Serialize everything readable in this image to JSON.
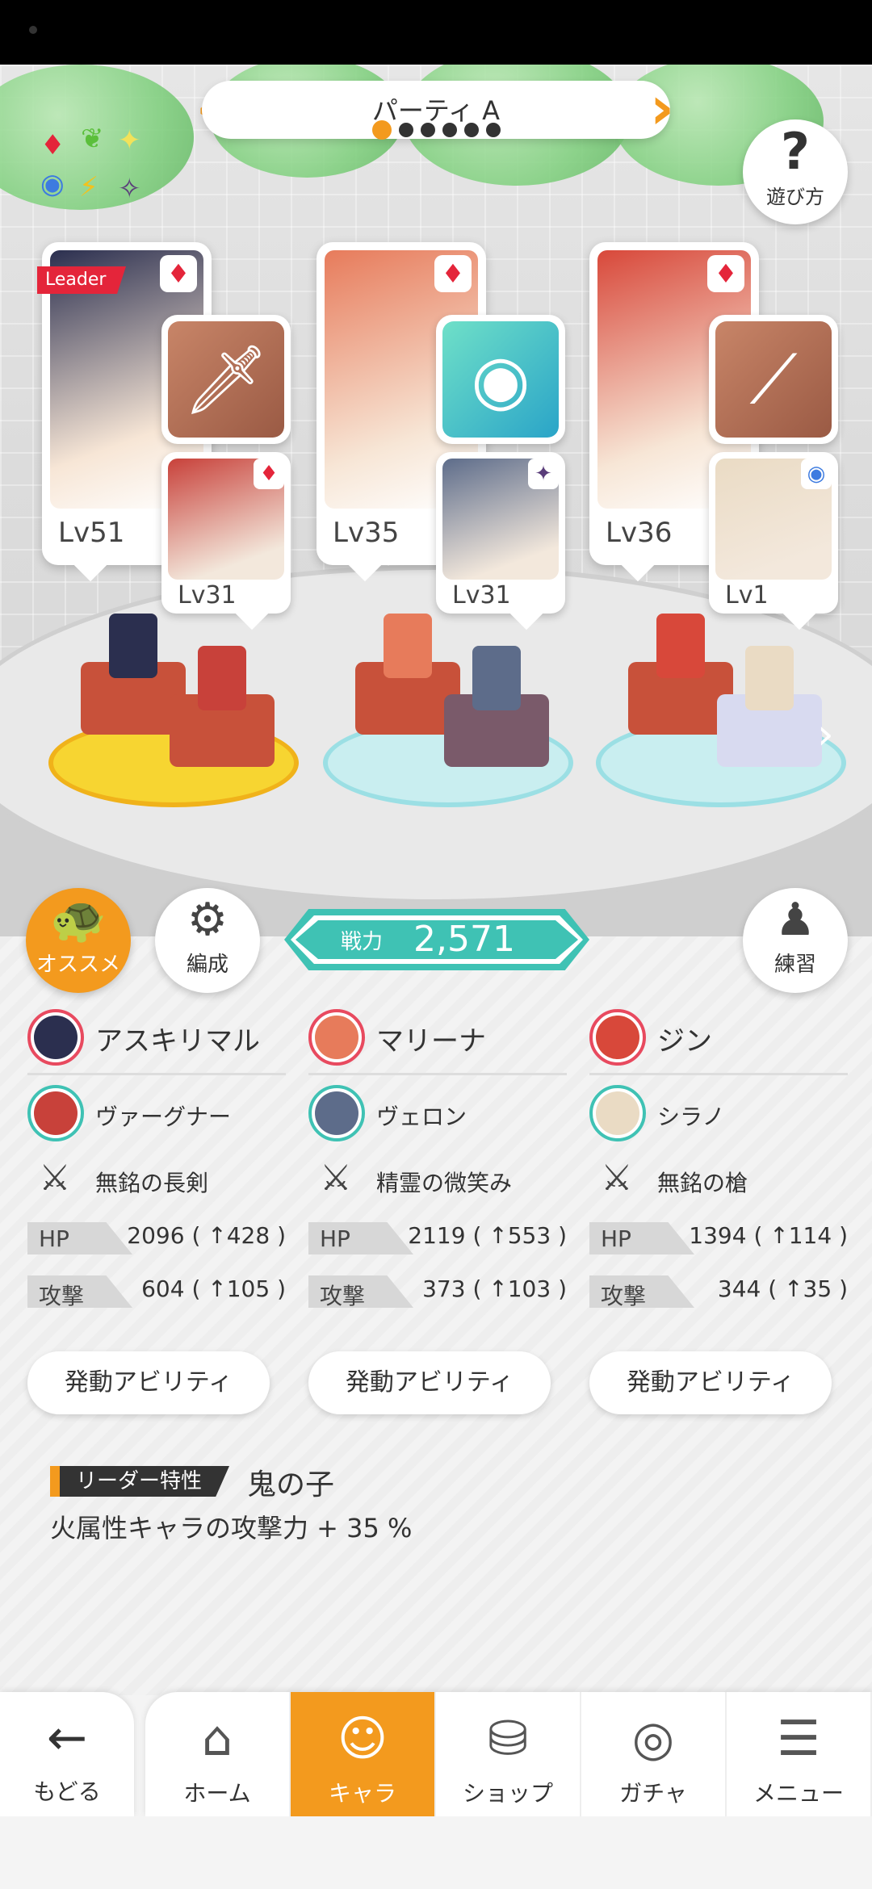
{
  "header": {
    "party_title": "パーティ A",
    "party_page_count": 6,
    "party_page_active": 0,
    "help_label": "遊び方",
    "help_icon": "question-icon"
  },
  "elements": {
    "symbols": [
      "♦",
      "❦",
      "✦",
      "◉",
      "⚡",
      "✧"
    ],
    "colors": [
      "#e4253a",
      "#5bbf3b",
      "#f2e25a",
      "#3d7be0",
      "#f2c21e",
      "#5a3d7a"
    ]
  },
  "leader_badge": "Leader",
  "team": [
    {
      "main": {
        "name": "アスキリマル",
        "level": "Lv51",
        "suit": "♦",
        "color": "#2b2f4f"
      },
      "sub": {
        "name": "ヴァーグナー",
        "level": "Lv31",
        "badge": "♦",
        "badge_color": "#e4253a",
        "color": "#c8413a"
      },
      "weapon": {
        "name": "無銘の長剣",
        "glyph": "🗡",
        "color": "#b06a4e"
      },
      "hp": "2096 ( ↑428 )",
      "atk": "604 ( ↑105 )"
    },
    {
      "main": {
        "name": "マリーナ",
        "level": "Lv35",
        "suit": "♦",
        "color": "#e77b5b"
      },
      "sub": {
        "name": "ヴェロン",
        "level": "Lv31",
        "badge": "✦",
        "badge_color": "#5a3d7a",
        "color": "#5d6c8a"
      },
      "weapon": {
        "name": "精霊の微笑み",
        "glyph": "◉",
        "color": "#3fc2b4"
      },
      "hp": "2119 ( ↑553 )",
      "atk": "373 ( ↑103 )"
    },
    {
      "main": {
        "name": "ジン",
        "level": "Lv36",
        "suit": "♦",
        "color": "#d8483a"
      },
      "sub": {
        "name": "シラノ",
        "level": "Lv1",
        "badge": "◉",
        "badge_color": "#3d7be0",
        "color": "#eadbc4"
      },
      "weapon": {
        "name": "無銘の槍",
        "glyph": "⟋",
        "color": "#b06a4e"
      },
      "hp": "1394 ( ↑114 )",
      "atk": "344 ( ↑35 )"
    }
  ],
  "stats_labels": {
    "hp": "HP",
    "atk": "攻撃"
  },
  "power": {
    "label": "戦力",
    "value": "2,571"
  },
  "actions": {
    "recommend": {
      "label": "オススメ",
      "icon": "turtle-icon"
    },
    "formation": {
      "label": "編成",
      "icon": "person-gear-icon"
    },
    "practice": {
      "label": "練習",
      "icon": "training-dummy-icon"
    }
  },
  "ability_button": "発動アビリティ",
  "leader": {
    "tag": "リーダー特性",
    "trait": "鬼の子",
    "description": "火属性キャラの攻撃力 + 35 %"
  },
  "nav": {
    "back": {
      "label": "もどる",
      "icon": "arrow-left-icon"
    },
    "items": [
      {
        "label": "ホーム",
        "icon": "home-icon"
      },
      {
        "label": "キャラ",
        "icon": "character-icon"
      },
      {
        "label": "ショップ",
        "icon": "shop-icon"
      },
      {
        "label": "ガチャ",
        "icon": "gacha-icon"
      },
      {
        "label": "メニュー",
        "icon": "menu-icon"
      }
    ],
    "active_index": 1
  }
}
